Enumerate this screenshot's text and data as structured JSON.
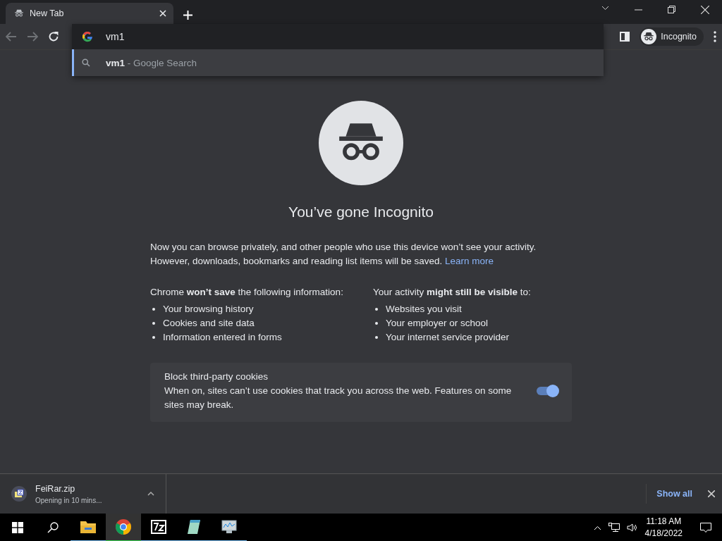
{
  "tabs": [
    {
      "title": "New Tab",
      "selected": true
    }
  ],
  "omnibox": {
    "value": "vm1",
    "suggestions": [
      {
        "query": "vm1",
        "source": "- Google Search",
        "selected": true
      }
    ]
  },
  "profile": {
    "label": "Incognito"
  },
  "page": {
    "title": "You’ve gone Incognito",
    "intro": "Now you can browse privately, and other people who use this device won’t see your activity. However, downloads, bookmarks and reading list items will be saved.",
    "link": "Learn more",
    "columns": [
      {
        "heading": "Chrome **won’t save** the following information:",
        "items": [
          "Your browsing history",
          "Cookies and site data",
          "Information entered in forms"
        ]
      },
      {
        "heading": "Your activity **might still be visible** to:",
        "items": [
          "Websites you visit",
          "Your employer or school",
          "Your internet service provider"
        ]
      }
    ],
    "cookie_card": {
      "title": "Block third-party cookies",
      "description": "When on, sites can’t use cookies that track you across the web. Features on some sites may break.",
      "on": true
    }
  },
  "download_bar": {
    "items": [
      {
        "name": "FeiRar.zip",
        "status": "Opening in 10 mins..."
      }
    ],
    "show_all": "Show all"
  },
  "taskbar": {
    "apps": [
      {
        "kind": "explorer",
        "running": true,
        "selected": false
      },
      {
        "kind": "chrome",
        "running": true,
        "selected": true
      },
      {
        "kind": "sevenzip",
        "running": true,
        "selected": false
      },
      {
        "kind": "notepad",
        "running": true,
        "selected": false
      },
      {
        "kind": "monitor",
        "running": true,
        "selected": false
      }
    ],
    "time": "11:18 AM",
    "date": "4/18/2022"
  }
}
